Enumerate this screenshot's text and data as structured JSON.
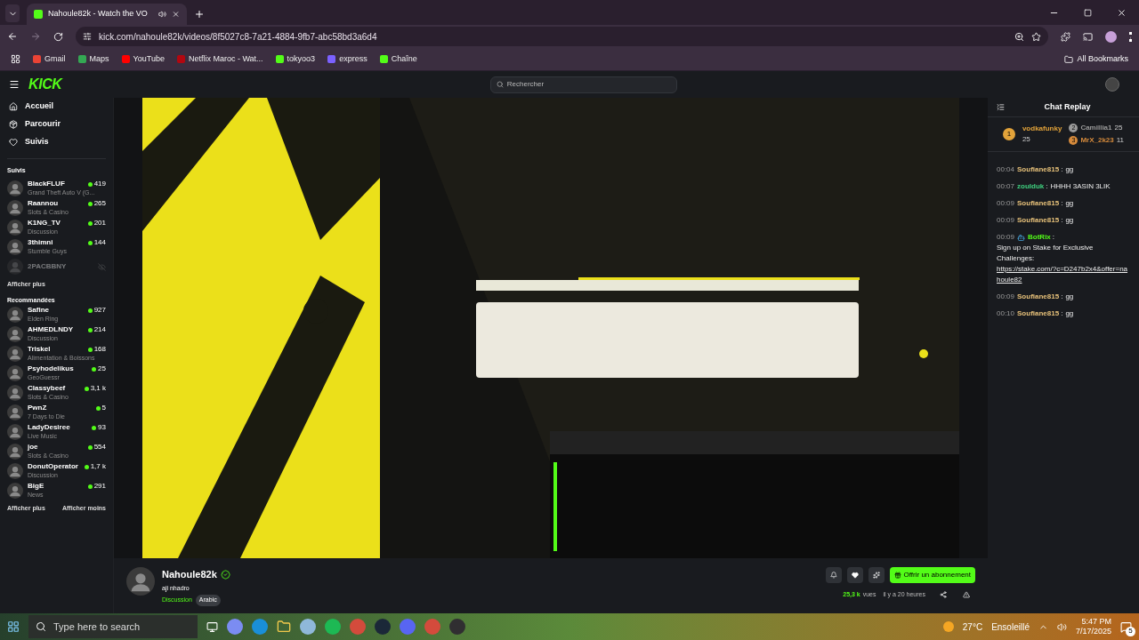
{
  "browser": {
    "tab_title": "Nahoule82k - Watch the VO",
    "url": "kick.com/nahoule82k/videos/8f5027c8-7a21-4884-9fb7-abc58bd3a6d4",
    "bookmarks": [
      {
        "label": "Gmail",
        "color": "#ea4335"
      },
      {
        "label": "Maps",
        "color": "#34a853"
      },
      {
        "label": "YouTube",
        "color": "#ff0000"
      },
      {
        "label": "Netflix Maroc - Wat...",
        "color": "#b20710"
      },
      {
        "label": "tokyoo3",
        "color": "#53fc18"
      },
      {
        "label": "express",
        "color": "#7b61ff"
      },
      {
        "label": "Chaîne",
        "color": "#53fc18"
      }
    ],
    "all_bookmarks": "All Bookmarks"
  },
  "topbar": {
    "logo": "KICK",
    "search_placeholder": "Rechercher"
  },
  "nav": [
    "Accueil",
    "Parcourir",
    "Suivis"
  ],
  "followed": {
    "title": "Suivis",
    "channels": [
      {
        "name": "BlackFLUF",
        "category": "Grand Theft Auto V (G...",
        "viewers": "419",
        "live": true
      },
      {
        "name": "Raannou",
        "category": "Slots & Casino",
        "viewers": "265",
        "live": true
      },
      {
        "name": "K1NG_TV",
        "category": "Discussion",
        "viewers": "201",
        "live": true
      },
      {
        "name": "3thimni",
        "category": "Stumble Guys",
        "viewers": "144",
        "live": true
      },
      {
        "name": "2PACBBNY",
        "live": false
      }
    ],
    "more": "Afficher plus"
  },
  "recommended": {
    "title": "Recommandées",
    "channels": [
      {
        "name": "Safine",
        "category": "Elden Ring",
        "viewers": "927"
      },
      {
        "name": "AHMEDLNDY",
        "category": "Discussion",
        "viewers": "214"
      },
      {
        "name": "Triskel",
        "category": "Alimentation & Boissons",
        "viewers": "168"
      },
      {
        "name": "Psyhodelikus",
        "category": "GeoGuessr",
        "viewers": "25"
      },
      {
        "name": "Classybeef",
        "category": "Slots & Casino",
        "viewers": "3,1 k"
      },
      {
        "name": "PwnZ",
        "category": "7 Days to Die",
        "viewers": "5"
      },
      {
        "name": "LadyDesiree",
        "category": "Live Music",
        "viewers": "93"
      },
      {
        "name": "joe",
        "category": "Slots & Casino",
        "viewers": "554"
      },
      {
        "name": "DonutOperator",
        "category": "Discussion",
        "viewers": "1,7 k"
      },
      {
        "name": "BigE",
        "category": "News",
        "viewers": "291"
      }
    ],
    "more": "Afficher plus",
    "less": "Afficher moins"
  },
  "channel": {
    "name": "Nahoule82k",
    "verified": true,
    "title": "aji nhadro",
    "category": "Discussion",
    "tag": "Arabic",
    "subscribe": "Offrir un abonnement",
    "views": "25,3 k",
    "views_label": "vues",
    "age": "il y a 20 heures"
  },
  "chat": {
    "title": "Chat Replay",
    "separator": ":",
    "leaders": [
      {
        "rank": "1",
        "name": "vodkafunky",
        "count": "25",
        "color": "#e2a33a"
      },
      {
        "rank": "2",
        "name": "Camillia1",
        "count": "25",
        "color": "#9a9a9a"
      },
      {
        "rank": "3",
        "name": "MrX_2k23",
        "count": "11",
        "color": "#d58a3c"
      }
    ],
    "messages": [
      {
        "time": "00:04",
        "user": "Soufiane815",
        "color": "#e8c27a",
        "text": "gg"
      },
      {
        "time": "00:07",
        "user": "zoulduk",
        "color": "#3fd07f",
        "text": "HHHH 3ASIN 3LIK"
      },
      {
        "time": "00:09",
        "user": "Soufiane815",
        "color": "#e8c27a",
        "text": "gg"
      },
      {
        "time": "00:09",
        "user": "Soufiane815",
        "color": "#e8c27a",
        "text": "gg"
      },
      {
        "time": "00:09",
        "user": "BotRix",
        "color": "#53fc18",
        "bot": true,
        "text": "Sign up on Stake for Exclusive Challenges:",
        "link": "https://stake.com/?c=D247b2x4&offer=nahoule82"
      },
      {
        "time": "00:09",
        "user": "Soufiane815",
        "color": "#e8c27a",
        "text": "gg"
      },
      {
        "time": "00:10",
        "user": "Soufiane815",
        "color": "#e8c27a",
        "text": "gg"
      }
    ]
  },
  "taskbar": {
    "search_placeholder": "Type here to search",
    "temperature": "27°C",
    "weather": "Ensoleillé",
    "time": "5:47 PM",
    "date": "7/17/2025",
    "notifications": "5"
  }
}
